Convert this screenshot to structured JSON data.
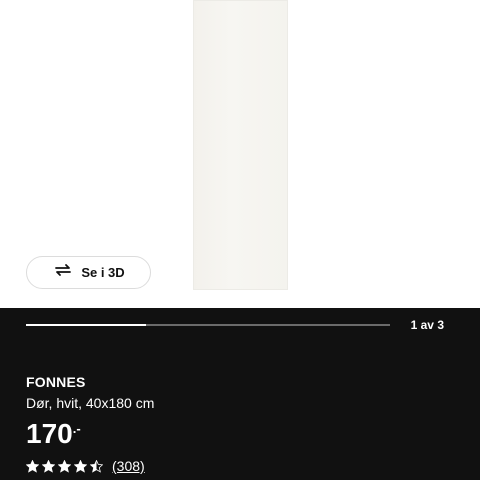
{
  "viewer": {
    "view_3d_label": "Se i 3D",
    "pager": "1 av 3",
    "progress_fraction": 0.33
  },
  "product": {
    "name": "FONNES",
    "description": "Dør, hvit, 40x180 cm",
    "price": "170",
    "price_suffix": ".-",
    "rating": 4.5,
    "review_count": "(308)"
  },
  "icons": {
    "view_3d": "rotate-arrows-icon",
    "star": "star-icon"
  }
}
